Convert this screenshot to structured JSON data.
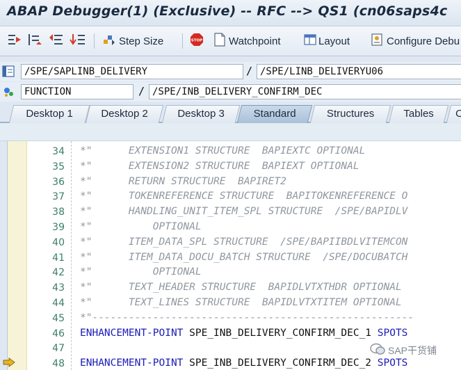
{
  "window": {
    "title": "ABAP Debugger(1)  (Exclusive) -- RFC --> QS1 (cn06saps4c"
  },
  "toolbar": {
    "step_icons": [
      "step-into-icon",
      "step-over-icon",
      "return-icon",
      "continue-icon"
    ],
    "step_size_label": "Step Size",
    "watchpoint_label": "Watchpoint",
    "layout_label": "Layout",
    "configure_label": "Configure Debu"
  },
  "context": {
    "program": "/SPE/SAPLINB_DELIVERY",
    "include": "/SPE/LINB_DELIVERYU06",
    "event_type": "FUNCTION",
    "event_name": "/SPE/INB_DELIVERY_CONFIRM_DEC"
  },
  "tabs": [
    "Desktop 1",
    "Desktop 2",
    "Desktop 3",
    "Standard",
    "Structures",
    "Tables",
    "O"
  ],
  "active_tab": "Standard",
  "code": {
    "lines": [
      {
        "no": "34",
        "text": "*\"      EXTENSION1 STRUCTURE  BAPIEXTC OPTIONAL"
      },
      {
        "no": "35",
        "text": "*\"      EXTENSION2 STRUCTURE  BAPIEXT OPTIONAL"
      },
      {
        "no": "36",
        "text": "*\"      RETURN STRUCTURE  BAPIRET2"
      },
      {
        "no": "37",
        "text": "*\"      TOKENREFERENCE STRUCTURE  BAPITOKENREFERENCE O"
      },
      {
        "no": "38",
        "text": "*\"      HANDLING_UNIT_ITEM_SPL STRUCTURE  /SPE/BAPIDLV"
      },
      {
        "no": "39",
        "text": "*\"          OPTIONAL"
      },
      {
        "no": "40",
        "text": "*\"      ITEM_DATA_SPL STRUCTURE  /SPE/BAPIIBDLVITEMCON"
      },
      {
        "no": "41",
        "text": "*\"      ITEM_DATA_DOCU_BATCH STRUCTURE  /SPE/DOCUBATCH"
      },
      {
        "no": "42",
        "text": "*\"          OPTIONAL"
      },
      {
        "no": "43",
        "text": "*\"      TEXT_HEADER STRUCTURE  BAPIDLVTXTHDR OPTIONAL"
      },
      {
        "no": "44",
        "text": "*\"      TEXT_LINES STRUCTURE  BAPIDLVTXTITEM OPTIONAL"
      },
      {
        "no": "45",
        "text": "*\"-----------------------------------------------------"
      },
      {
        "no": "46",
        "kw": "ENHANCEMENT-POINT",
        "rest": " SPE_INB_DELIVERY_CONFIRM_DEC_1 ",
        "kw2": "SPOTS"
      },
      {
        "no": "47",
        "text": ""
      },
      {
        "no": "48",
        "kw": "ENHANCEMENT-POINT",
        "rest": " SPE_INB_DELIVERY_CONFIRM_DEC_2 ",
        "kw2": "SPOTS"
      }
    ]
  },
  "watermark": {
    "text": "SAP干货铺"
  },
  "colors": {
    "line_number": "#3c7d6b",
    "comment": "#9097a0",
    "keyword": "#1b1bb8",
    "active_tab": "#aac1d9"
  }
}
